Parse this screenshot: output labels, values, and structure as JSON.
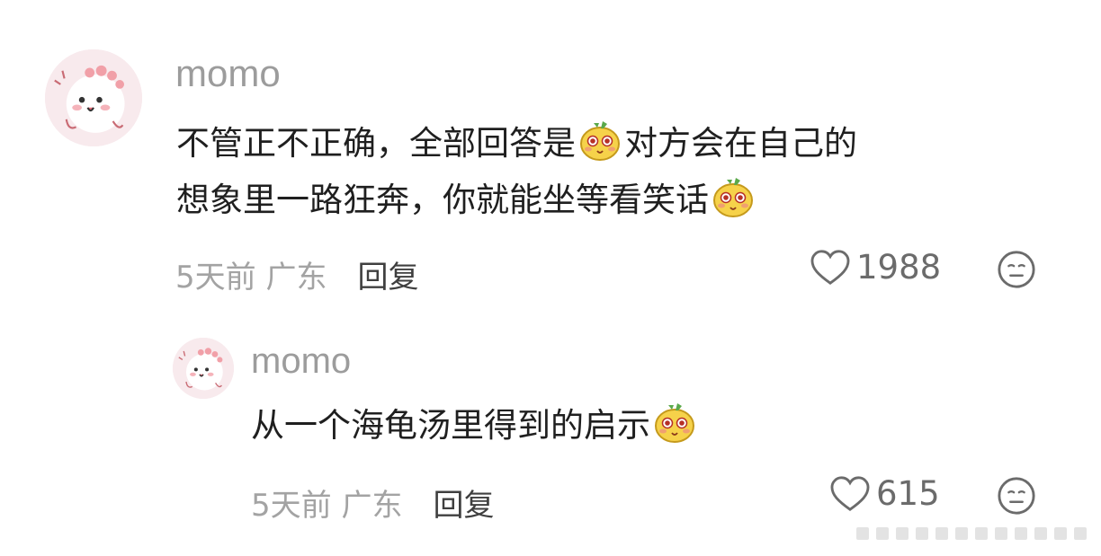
{
  "comments": [
    {
      "username": "momo",
      "text_line1_a": "不管正不正确，全部回答是",
      "text_line1_b": "对方会在自己的",
      "text_line2": "想象里一路狂奔，你就能坐等看笑话",
      "time_location": "5天前 广东",
      "reply_label": "回复",
      "like_count": "1988",
      "icons": {
        "avatar": "avatar-icon",
        "emoji": "yellow-mascot-emoji-icon",
        "like": "heart-icon",
        "react": "neutral-face-icon"
      }
    },
    {
      "username": "momo",
      "text": "从一个海龟汤里得到的启示",
      "time_location": "5天前 广东",
      "reply_label": "回复",
      "like_count": "615",
      "icons": {
        "avatar": "avatar-icon",
        "emoji": "yellow-mascot-emoji-icon",
        "like": "heart-icon",
        "react": "neutral-face-icon"
      }
    }
  ],
  "colors": {
    "background": "#ffffff",
    "username": "#9c9c9c",
    "text": "#1f1f1f",
    "meta": "#a3a3a3",
    "reply": "#3f3f3f",
    "avatar_bg": "#f7e9ec"
  }
}
